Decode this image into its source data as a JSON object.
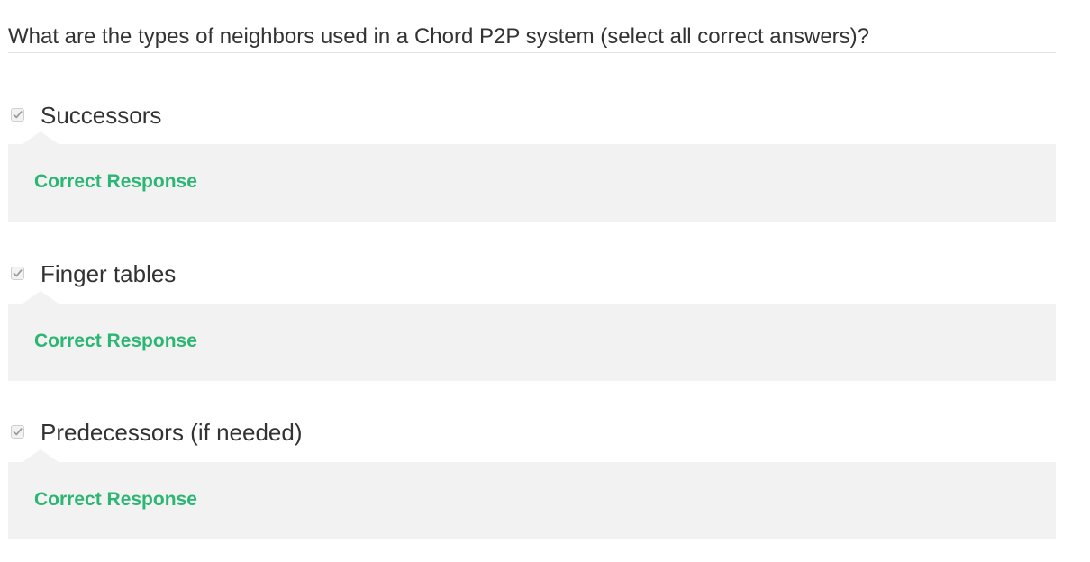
{
  "question": {
    "text": "What are the types of neighbors used in a Chord P2P system (select all correct answers)?"
  },
  "colors": {
    "correct": "#2bb673",
    "feedback_bg": "#f2f2f2",
    "check": "#9b9b9b"
  },
  "options": [
    {
      "label": "Successors",
      "checked": true,
      "feedback": "Correct Response"
    },
    {
      "label": "Finger tables",
      "checked": true,
      "feedback": "Correct Response"
    },
    {
      "label": "Predecessors (if needed)",
      "checked": true,
      "feedback": "Correct Response"
    }
  ]
}
